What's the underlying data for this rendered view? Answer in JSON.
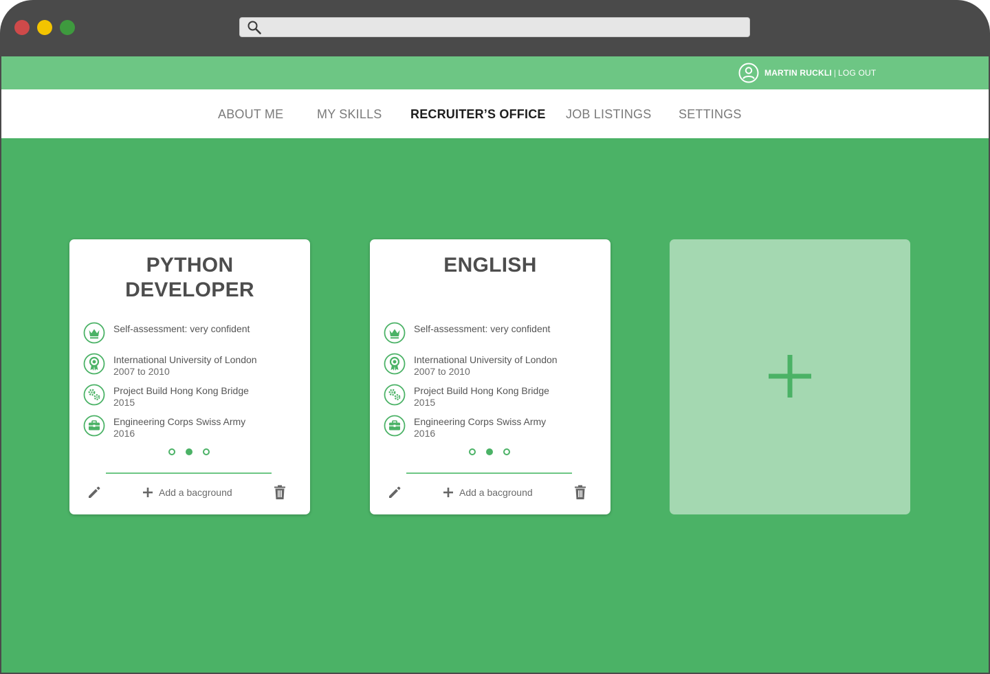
{
  "browser": {
    "address_value": "",
    "dots": [
      {
        "color": "#cf4a4a"
      },
      {
        "color": "#f3c400"
      },
      {
        "color": "#3e9a3e"
      }
    ]
  },
  "colors": {
    "brand_green": "#4bb266",
    "light_green": "#6dc684",
    "pale_green": "#a4d8b1"
  },
  "header": {
    "user_name": "MARTIN RUCKLI",
    "separator": "|",
    "logout_label": "LOG OUT",
    "user_icon": "user-circle-icon"
  },
  "nav": {
    "items": [
      {
        "label": "ABOUT ME"
      },
      {
        "label": "MY SKILLS"
      },
      {
        "label": "RECRUITER’S OFFICE",
        "active": true
      },
      {
        "label": "JOB LISTINGS"
      },
      {
        "label": "SETTINGS"
      }
    ]
  },
  "cards": [
    {
      "title_line1": "PYTHON",
      "title_line2": "DEVELOPER",
      "entries": [
        {
          "icon": "crown-icon",
          "line1": "Self-assessment: very confident",
          "line2": ""
        },
        {
          "icon": "award-ribbon-icon",
          "line1": "International University of London",
          "line2": "2007 to 2010"
        },
        {
          "icon": "gears-icon",
          "line1": "Project Build Hong Kong Bridge",
          "line2": "2015"
        },
        {
          "icon": "briefcase-icon",
          "line1": "Engineering Corps Swiss Army",
          "line2": "2016"
        }
      ],
      "pager_active_index": 1,
      "add_label": "Add a bacground"
    },
    {
      "title_line1": "ENGLISH",
      "title_line2": "",
      "entries": [
        {
          "icon": "crown-icon",
          "line1": "Self-assessment: very confident",
          "line2": ""
        },
        {
          "icon": "award-ribbon-icon",
          "line1": "International University of London",
          "line2": "2007 to 2010"
        },
        {
          "icon": "gears-icon",
          "line1": "Project Build Hong Kong Bridge",
          "line2": "2015"
        },
        {
          "icon": "briefcase-icon",
          "line1": "Engineering Corps Swiss Army",
          "line2": "2016"
        }
      ],
      "pager_active_index": 1,
      "add_label": "Add a bacground"
    }
  ],
  "add_card": {
    "icon": "plus-icon"
  }
}
